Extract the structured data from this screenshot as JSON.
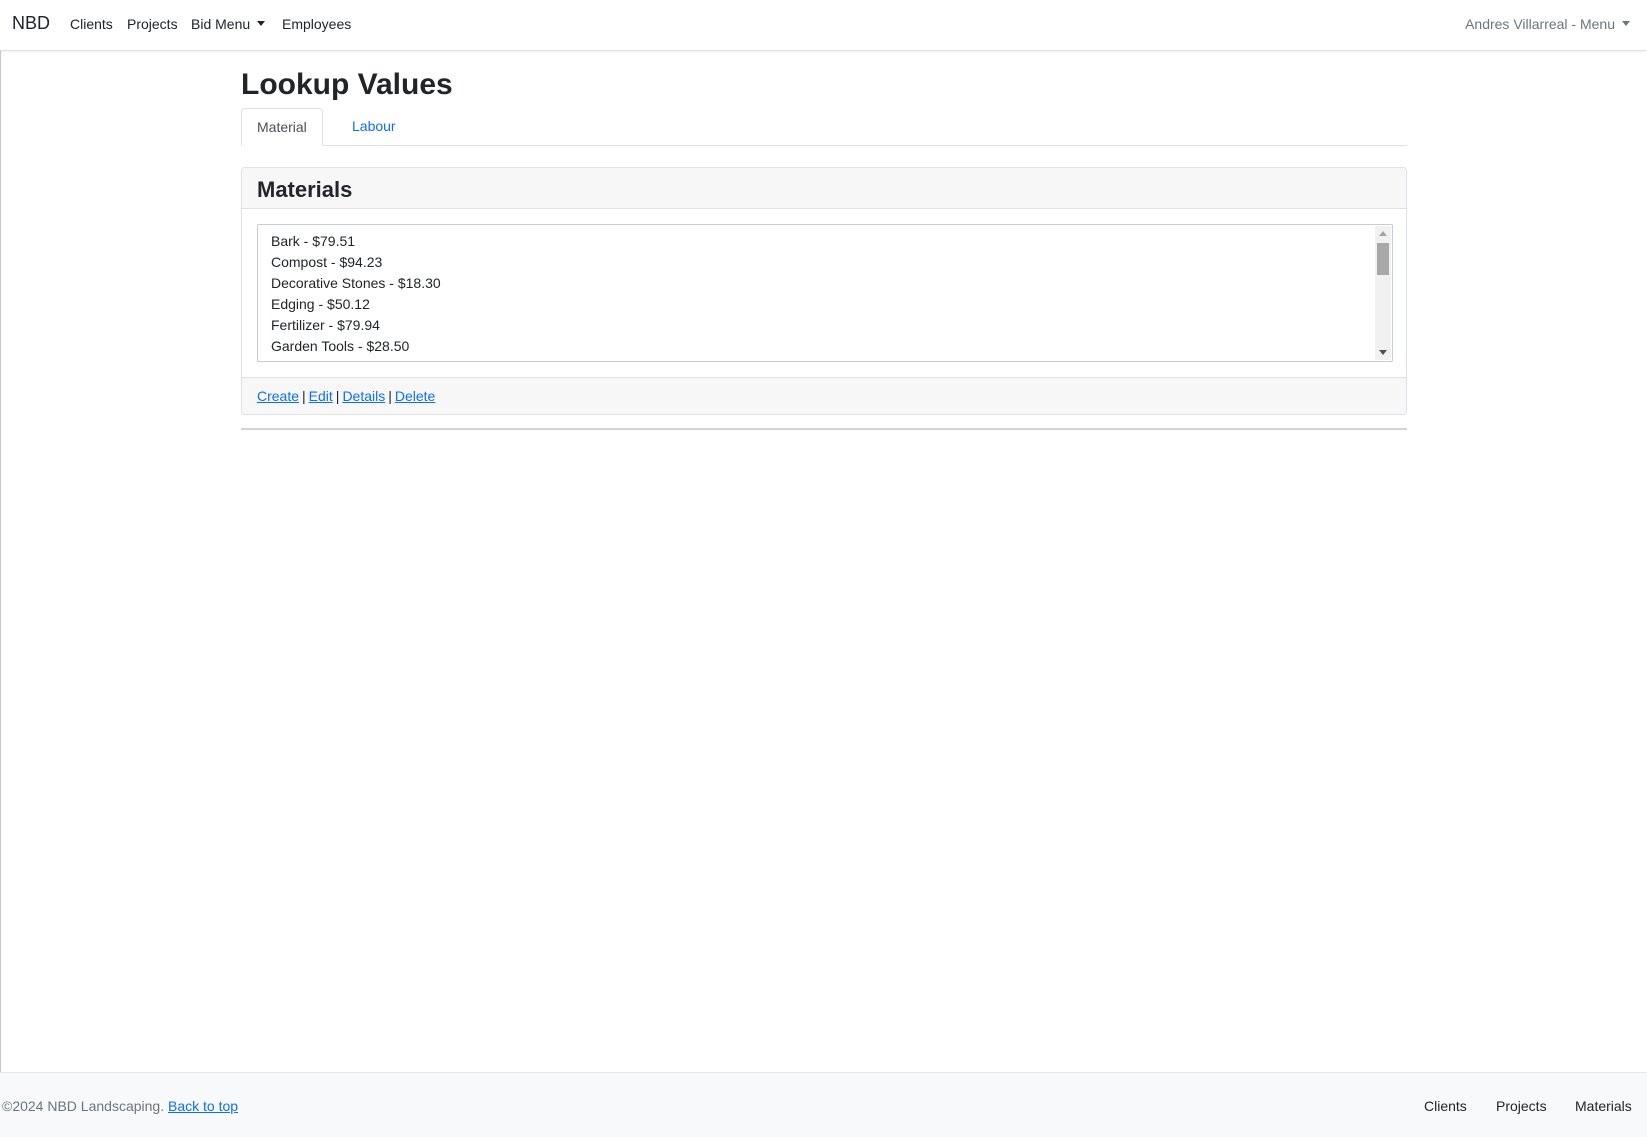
{
  "navbar": {
    "brand": "NBD",
    "links": {
      "clients": "Clients",
      "projects": "Projects",
      "bid_menu": "Bid Menu",
      "employees": "Employees"
    },
    "user_menu": "Andres Villarreal - Menu"
  },
  "page": {
    "title": "Lookup Values"
  },
  "tabs": {
    "material": "Material",
    "labour": "Labour",
    "active": "Material"
  },
  "materials": {
    "heading": "Materials",
    "items": [
      "Bark - $79.51",
      "Compost - $94.23",
      "Decorative Stones - $18.30",
      "Edging - $50.12",
      "Fertilizer - $79.94",
      "Garden Tools - $28.50"
    ],
    "actions": {
      "create": "Create",
      "edit": "Edit",
      "details": "Details",
      "delete": "Delete",
      "separator": "|"
    }
  },
  "footer": {
    "copyright": "©2024 NBD Landscaping.",
    "back_to_top": "Back to top",
    "links": {
      "clients": "Clients",
      "projects": "Projects",
      "materials": "Materials"
    }
  },
  "colors": {
    "link": "#0d6efd",
    "muted": "#6c757d",
    "header_bg": "#f7f7f7"
  }
}
